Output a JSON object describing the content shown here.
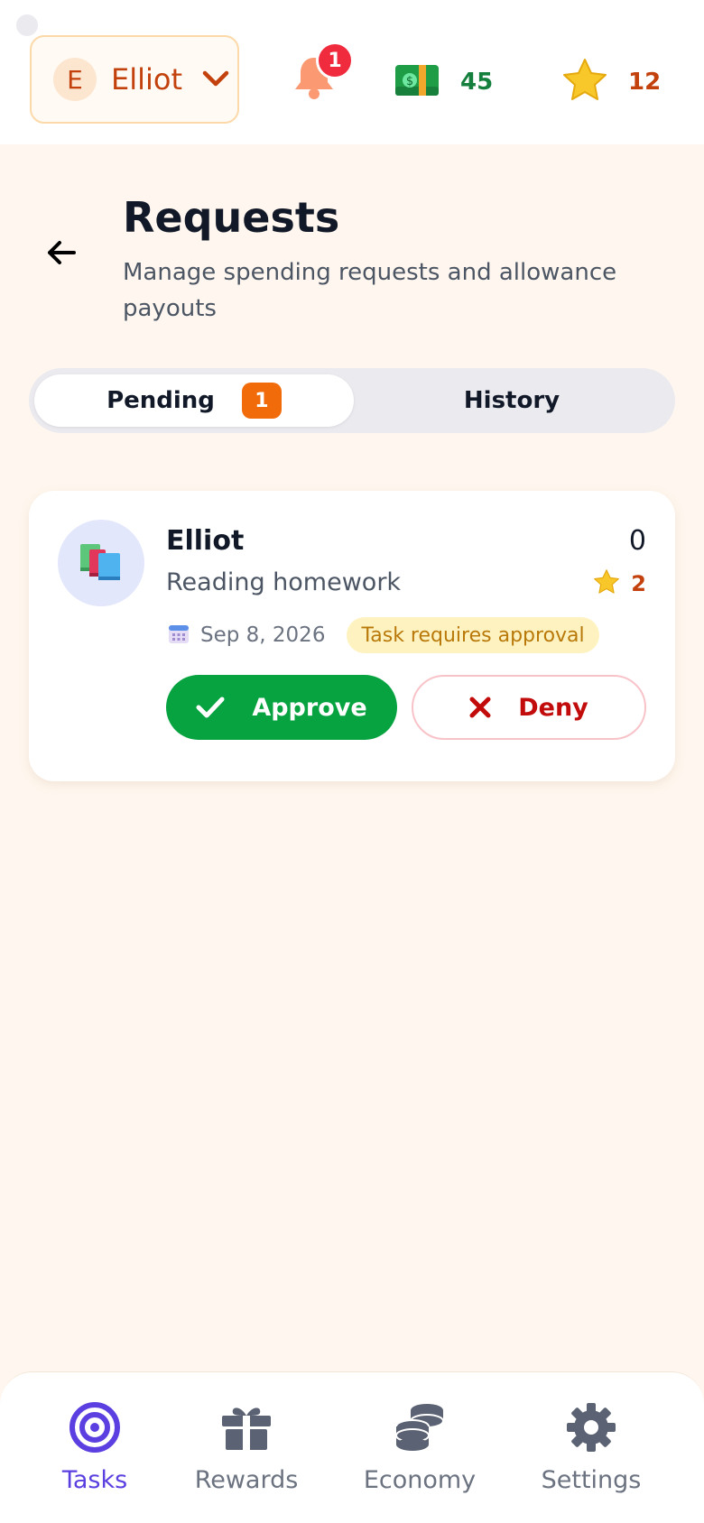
{
  "header": {
    "profile": {
      "initial": "E",
      "name": "Elliot"
    },
    "notifications": {
      "count": "1"
    },
    "money": {
      "value": "45"
    },
    "stars": {
      "value": "12"
    }
  },
  "page": {
    "title": "Requests",
    "subtitle": "Manage spending requests and allowance payouts"
  },
  "tabs": {
    "pending": {
      "label": "Pending",
      "count": "1"
    },
    "history": {
      "label": "History"
    }
  },
  "requests": [
    {
      "name": "Elliot",
      "amount": "0",
      "task": "Reading homework",
      "stars": "2",
      "date": "Sep 8, 2026",
      "tag": "Task requires approval",
      "approve_label": "Approve",
      "deny_label": "Deny",
      "icon": "books-icon"
    }
  ],
  "bottom_nav": {
    "items": [
      {
        "label": "Tasks",
        "icon": "target-icon"
      },
      {
        "label": "Rewards",
        "icon": "gift-icon"
      },
      {
        "label": "Economy",
        "icon": "coins-icon"
      },
      {
        "label": "Settings",
        "icon": "gear-icon"
      }
    ],
    "active": "Tasks"
  },
  "colors": {
    "accent": "#f26b0a",
    "approve": "#06a340",
    "deny": "#c20b0b",
    "nav_active": "#5b3fe0",
    "background": "#fff7ef"
  }
}
